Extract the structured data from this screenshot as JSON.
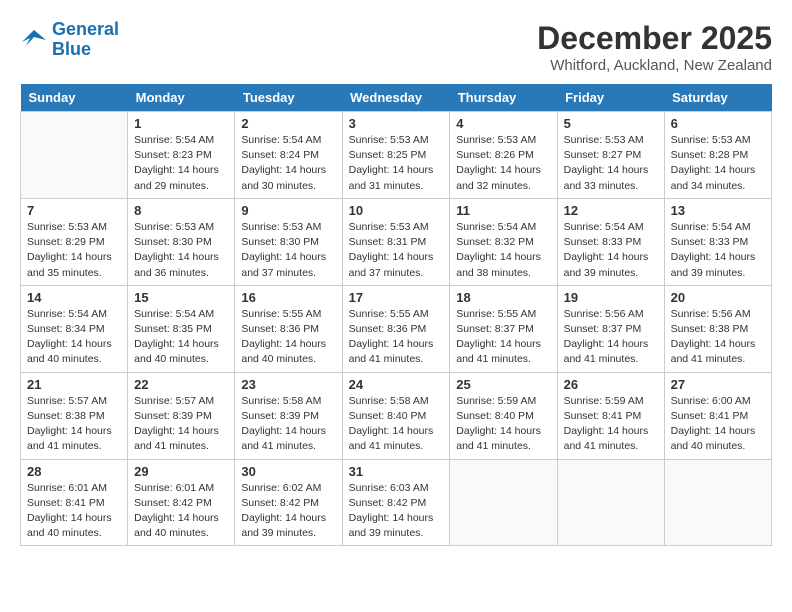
{
  "header": {
    "logo_line1": "General",
    "logo_line2": "Blue",
    "month": "December 2025",
    "location": "Whitford, Auckland, New Zealand"
  },
  "days": [
    "Sunday",
    "Monday",
    "Tuesday",
    "Wednesday",
    "Thursday",
    "Friday",
    "Saturday"
  ],
  "weeks": [
    [
      {
        "date": "",
        "info": ""
      },
      {
        "date": "1",
        "info": "Sunrise: 5:54 AM\nSunset: 8:23 PM\nDaylight: 14 hours\nand 29 minutes."
      },
      {
        "date": "2",
        "info": "Sunrise: 5:54 AM\nSunset: 8:24 PM\nDaylight: 14 hours\nand 30 minutes."
      },
      {
        "date": "3",
        "info": "Sunrise: 5:53 AM\nSunset: 8:25 PM\nDaylight: 14 hours\nand 31 minutes."
      },
      {
        "date": "4",
        "info": "Sunrise: 5:53 AM\nSunset: 8:26 PM\nDaylight: 14 hours\nand 32 minutes."
      },
      {
        "date": "5",
        "info": "Sunrise: 5:53 AM\nSunset: 8:27 PM\nDaylight: 14 hours\nand 33 minutes."
      },
      {
        "date": "6",
        "info": "Sunrise: 5:53 AM\nSunset: 8:28 PM\nDaylight: 14 hours\nand 34 minutes."
      }
    ],
    [
      {
        "date": "7",
        "info": "Sunrise: 5:53 AM\nSunset: 8:29 PM\nDaylight: 14 hours\nand 35 minutes."
      },
      {
        "date": "8",
        "info": "Sunrise: 5:53 AM\nSunset: 8:30 PM\nDaylight: 14 hours\nand 36 minutes."
      },
      {
        "date": "9",
        "info": "Sunrise: 5:53 AM\nSunset: 8:30 PM\nDaylight: 14 hours\nand 37 minutes."
      },
      {
        "date": "10",
        "info": "Sunrise: 5:53 AM\nSunset: 8:31 PM\nDaylight: 14 hours\nand 37 minutes."
      },
      {
        "date": "11",
        "info": "Sunrise: 5:54 AM\nSunset: 8:32 PM\nDaylight: 14 hours\nand 38 minutes."
      },
      {
        "date": "12",
        "info": "Sunrise: 5:54 AM\nSunset: 8:33 PM\nDaylight: 14 hours\nand 39 minutes."
      },
      {
        "date": "13",
        "info": "Sunrise: 5:54 AM\nSunset: 8:33 PM\nDaylight: 14 hours\nand 39 minutes."
      }
    ],
    [
      {
        "date": "14",
        "info": "Sunrise: 5:54 AM\nSunset: 8:34 PM\nDaylight: 14 hours\nand 40 minutes."
      },
      {
        "date": "15",
        "info": "Sunrise: 5:54 AM\nSunset: 8:35 PM\nDaylight: 14 hours\nand 40 minutes."
      },
      {
        "date": "16",
        "info": "Sunrise: 5:55 AM\nSunset: 8:36 PM\nDaylight: 14 hours\nand 40 minutes."
      },
      {
        "date": "17",
        "info": "Sunrise: 5:55 AM\nSunset: 8:36 PM\nDaylight: 14 hours\nand 41 minutes."
      },
      {
        "date": "18",
        "info": "Sunrise: 5:55 AM\nSunset: 8:37 PM\nDaylight: 14 hours\nand 41 minutes."
      },
      {
        "date": "19",
        "info": "Sunrise: 5:56 AM\nSunset: 8:37 PM\nDaylight: 14 hours\nand 41 minutes."
      },
      {
        "date": "20",
        "info": "Sunrise: 5:56 AM\nSunset: 8:38 PM\nDaylight: 14 hours\nand 41 minutes."
      }
    ],
    [
      {
        "date": "21",
        "info": "Sunrise: 5:57 AM\nSunset: 8:38 PM\nDaylight: 14 hours\nand 41 minutes."
      },
      {
        "date": "22",
        "info": "Sunrise: 5:57 AM\nSunset: 8:39 PM\nDaylight: 14 hours\nand 41 minutes."
      },
      {
        "date": "23",
        "info": "Sunrise: 5:58 AM\nSunset: 8:39 PM\nDaylight: 14 hours\nand 41 minutes."
      },
      {
        "date": "24",
        "info": "Sunrise: 5:58 AM\nSunset: 8:40 PM\nDaylight: 14 hours\nand 41 minutes."
      },
      {
        "date": "25",
        "info": "Sunrise: 5:59 AM\nSunset: 8:40 PM\nDaylight: 14 hours\nand 41 minutes."
      },
      {
        "date": "26",
        "info": "Sunrise: 5:59 AM\nSunset: 8:41 PM\nDaylight: 14 hours\nand 41 minutes."
      },
      {
        "date": "27",
        "info": "Sunrise: 6:00 AM\nSunset: 8:41 PM\nDaylight: 14 hours\nand 40 minutes."
      }
    ],
    [
      {
        "date": "28",
        "info": "Sunrise: 6:01 AM\nSunset: 8:41 PM\nDaylight: 14 hours\nand 40 minutes."
      },
      {
        "date": "29",
        "info": "Sunrise: 6:01 AM\nSunset: 8:42 PM\nDaylight: 14 hours\nand 40 minutes."
      },
      {
        "date": "30",
        "info": "Sunrise: 6:02 AM\nSunset: 8:42 PM\nDaylight: 14 hours\nand 39 minutes."
      },
      {
        "date": "31",
        "info": "Sunrise: 6:03 AM\nSunset: 8:42 PM\nDaylight: 14 hours\nand 39 minutes."
      },
      {
        "date": "",
        "info": ""
      },
      {
        "date": "",
        "info": ""
      },
      {
        "date": "",
        "info": ""
      }
    ]
  ]
}
